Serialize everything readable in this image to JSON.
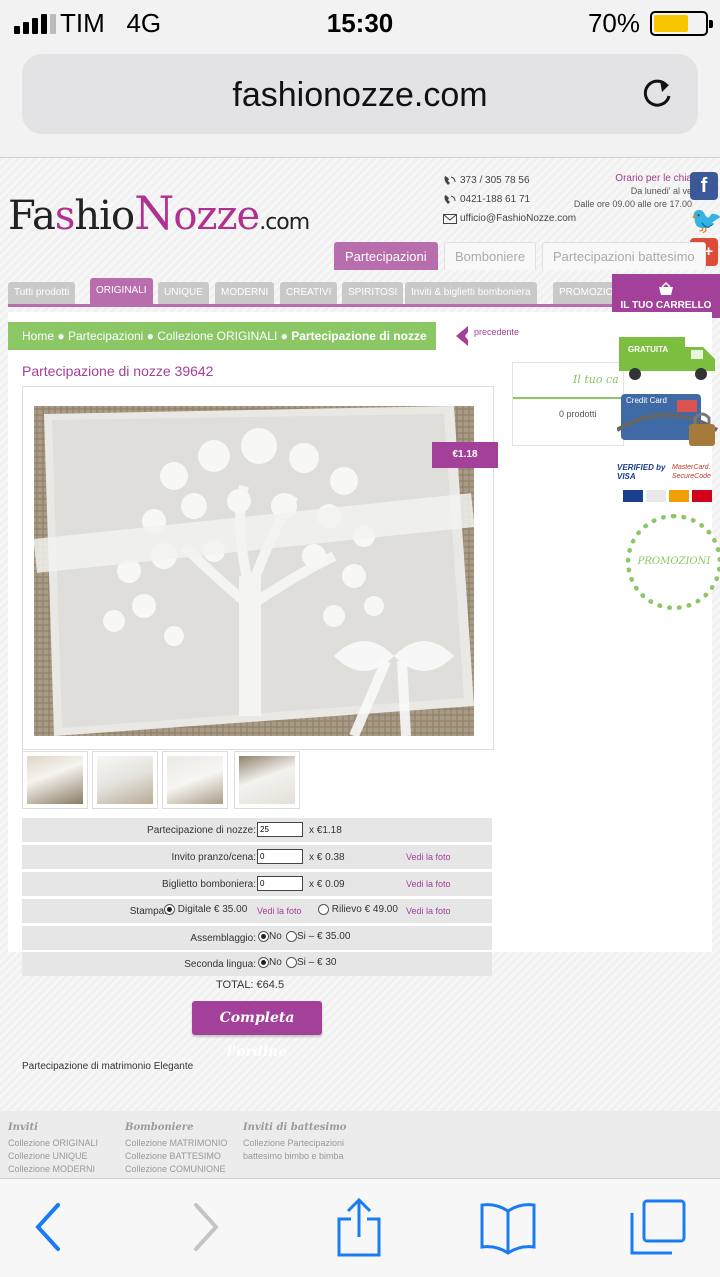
{
  "status_bar": {
    "carrier": "TIM",
    "network": "4G",
    "time": "15:30",
    "battery": "70%",
    "battery_level": 0.7
  },
  "browser": {
    "url": "fashionozze.com"
  },
  "site": {
    "logo": {
      "part1": "Fa",
      "part2": "s",
      "part3": "hio",
      "part4": "N",
      "part5": "ozze",
      "part6": ".com"
    },
    "phone1": "373 / 305 78 56",
    "phone2": "0421-188 61 71",
    "email": "ufficio@FashioNozze.com",
    "hours_title": "Orario per le chia",
    "hours_days": "Da lunedi' al ve",
    "hours_time": "Dalle ore 09.00 alle ore 17.00",
    "main_tabs": [
      "Partecipazioni",
      "Bomboniere",
      "Partecipazioni battesimo"
    ],
    "sub_tabs": [
      "Tutti prodotti",
      "ORIGINALI",
      "UNIQUE",
      "MODERNI",
      "CREATIVI",
      "SPIRITOSI",
      "Inviti & biglietti bomboniera",
      "PROMOZIO"
    ],
    "cart_label": "IL TUO CARRELLO",
    "breadcrumb": {
      "home": "Home",
      "sep": "●",
      "level1": "Partecipazioni",
      "level2": "Collezione ORIGINALI",
      "current": "Partecipazione di nozze"
    },
    "prev_label": "precedente"
  },
  "product": {
    "title": "Partecipazione di nozze 39642",
    "price_tag": "€1.18",
    "minicart_title": "Il tuo ca",
    "minicart_count": "0 prodotti",
    "rows": [
      {
        "label": "Partecipazione di nozze:",
        "value": "25",
        "mult": "x €1.18",
        "link": ""
      },
      {
        "label": "Invito pranzo/cena:",
        "value": "0",
        "mult": "x € 0.38",
        "link": "Vedi la foto"
      },
      {
        "label": "Biglietto bomboniera:",
        "value": "0",
        "mult": "x € 0.09",
        "link": "Vedi la foto"
      }
    ],
    "stampa": {
      "label": "Stampa:",
      "opt1": "Digitale € 35.00",
      "opt1_link": "Vedi la foto",
      "opt2": "Rilievo € 49.00",
      "opt2_link": "Vedi la foto"
    },
    "assemblaggio": {
      "label": "Assemblaggio:",
      "no": "No",
      "si": "Si – € 35.00"
    },
    "seconda": {
      "label": "Seconda lingua:",
      "no": "No",
      "si": "Si – € 30"
    },
    "total": "TOTAL: €64.5",
    "button": "Completa l'ordine",
    "description": "Partecipazione di matrimonio Elegante"
  },
  "side": {
    "truck": "GRATUITA",
    "credit": "Credit Card",
    "verified": "VERIFIED by VISA",
    "mastercard": "MasterCard. SecureCode",
    "promo": "PROMOZIONI"
  },
  "footer": {
    "col1": {
      "title": "Inviti",
      "items": [
        "Collezione ORIGINALI",
        "Collezione UNIQUE",
        "Collezione MODERNI"
      ]
    },
    "col2": {
      "title": "Bomboniere",
      "items": [
        "Collezione MATRIMONIO",
        "Collezione BATTESIMO",
        "Collezione COMUNIONE"
      ]
    },
    "col3": {
      "title": "Inviti di battesimo",
      "items": [
        "Collezione Partecipazioni",
        "battesimo bimbo e bimba"
      ]
    }
  },
  "colors": {
    "accent": "#a3409a",
    "green": "#8bc764",
    "ios_blue": "#1a7cf5"
  }
}
